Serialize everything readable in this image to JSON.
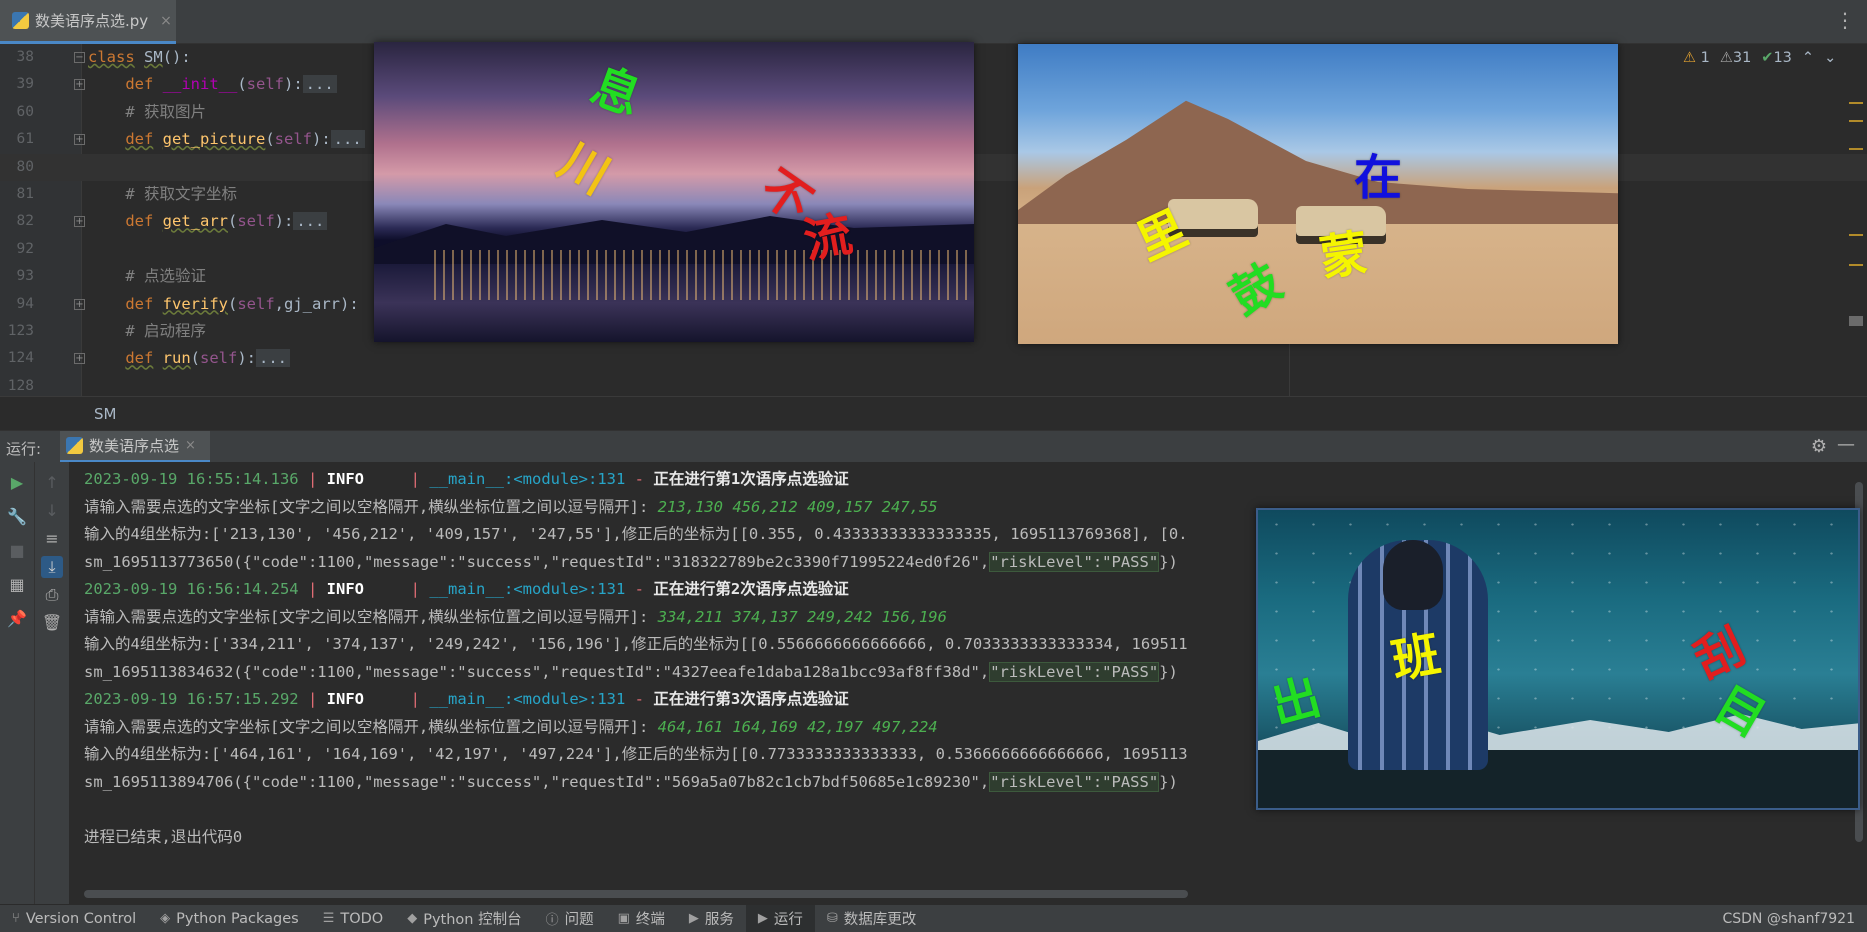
{
  "editor_tab": {
    "file_name": "数美语序点选.py",
    "close": "×"
  },
  "inspections": {
    "warn_a": "1",
    "warn_b": "31",
    "ok": "13"
  },
  "code_lines": [
    {
      "num": "38"
    },
    {
      "num": "39"
    },
    {
      "num": "60"
    },
    {
      "num": "61"
    },
    {
      "num": "80"
    },
    {
      "num": "81"
    },
    {
      "num": "82"
    },
    {
      "num": "92"
    },
    {
      "num": "93"
    },
    {
      "num": "94"
    },
    {
      "num": "123"
    },
    {
      "num": "124"
    },
    {
      "num": "128"
    }
  ],
  "code": {
    "l38_kw": "class",
    "l38_name": "SM",
    "l38_rest": "():",
    "l39_kw": "def",
    "l39_name": "__init__",
    "l39_self": "self",
    "l39_ph": "...",
    "l60_comment": "# 获取图片",
    "l61_kw": "def",
    "l61_name": "get_picture",
    "l61_self": "self",
    "l61_ph": "...",
    "l81_comment": "# 获取文字坐标",
    "l82_kw": "def",
    "l82_name": "get_arr",
    "l82_self": "self",
    "l82_ph": "...",
    "l93_comment": "# 点选验证",
    "l94_kw": "def",
    "l94_name": "fverify",
    "l94_self": "self",
    "l94_arg": "gj_arr",
    "l123_comment": "# 启动程序",
    "l124_kw": "def",
    "l124_name": "run",
    "l124_self": "self",
    "l124_ph": "..."
  },
  "breadcrumb": "SM",
  "images": {
    "pic1_chars": [
      "息",
      "川",
      "不",
      "流"
    ],
    "pic2_chars": [
      "在",
      "里",
      "蒙",
      "鼓"
    ],
    "pic3_chars": [
      "出",
      "班",
      "刮",
      "目"
    ]
  },
  "run_panel": {
    "label": "运行:",
    "tab_name": "数美语序点选",
    "close": "×"
  },
  "console": {
    "log1_ts": "2023-09-19 16:55:14.136",
    "log1_msg": "正在进行第1次语序点选验证",
    "prompt": "请输入需要点选的文字坐标[文字之间以空格隔开,横纵坐标位置之间以逗号隔开]: ",
    "input1": "213,130 456,212 409,157 247,55",
    "result1": "输入的4组坐标为:['213,130', '456,212', '409,157', '247,55'],修正后的坐标为[[0.355, 0.43333333333333335, 1695113769368], [0.",
    "resp1_a": "sm_1695113773650({\"code\":1100,\"message\":\"success\",\"requestId\":\"318322789be2c3390f71995224ed0f26\",",
    "resp1_b": "\"riskLevel\":\"PASS\"",
    "resp1_c": "})",
    "log2_ts": "2023-09-19 16:56:14.254",
    "log2_msg": "正在进行第2次语序点选验证",
    "input2": "334,211 374,137 249,242 156,196",
    "result2": "输入的4组坐标为:['334,211', '374,137', '249,242', '156,196'],修正后的坐标为[[0.5566666666666666, 0.7033333333333334, 169511",
    "resp2_a": "sm_1695113834632({\"code\":1100,\"message\":\"success\",\"requestId\":\"4327eeafe1daba128a1bcc93af8ff38d\",",
    "resp2_b": "\"riskLevel\":\"PASS\"",
    "resp2_c": "})",
    "log3_ts": "2023-09-19 16:57:15.292",
    "log3_msg": "正在进行第3次语序点选验证",
    "input3": "464,161 164,169 42,197 497,224",
    "result3": "输入的4组坐标为:['464,161', '164,169', '42,197', '497,224'],修正后的坐标为[[0.7733333333333333, 0.5366666666666666, 1695113",
    "resp3_a": "sm_1695113894706({\"code\":1100,\"message\":\"success\",\"requestId\":\"569a5a07b82c1cb7bdf50685e1c89230\",",
    "resp3_b": "\"riskLevel\":\"PASS\"",
    "resp3_c": "})",
    "level": "INFO",
    "bar": "|",
    "module": "__main__:<module>:131",
    "dash": "-",
    "exit": "进程已结束,退出代码0"
  },
  "statusbar": {
    "version_control": "Version Control",
    "python_packages": "Python Packages",
    "todo": "TODO",
    "python_console": "Python 控制台",
    "problems": "问题",
    "terminal": "终端",
    "services": "服务",
    "run": "运行",
    "db_changes": "数据库更改",
    "watermark": "CSDN @shanf7921"
  },
  "colors": {
    "accent": "#4a88c7",
    "keyword": "#cc7832",
    "function": "#ffc66d",
    "self": "#94558d",
    "timestamp": "#59a869",
    "module": "#27a5c8"
  }
}
